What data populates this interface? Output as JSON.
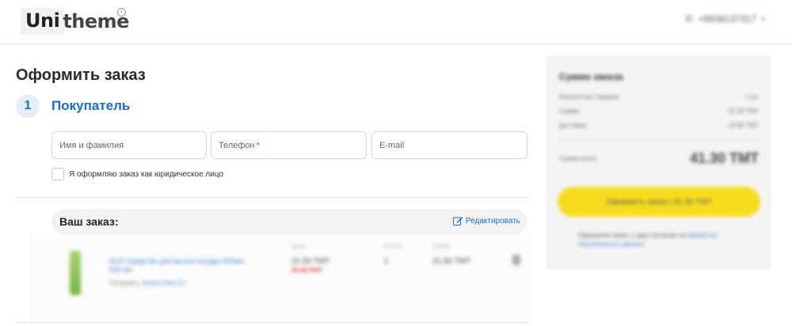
{
  "header": {
    "logo_a": "Uni",
    "logo_b": "theme",
    "phone": "+8938137317"
  },
  "checkout": {
    "title": "Оформить заказ",
    "step_number": "1",
    "step_title": "Покупатель",
    "fields": {
      "name_placeholder": "Имя и фамилия",
      "phone_placeholder": "Телефон",
      "phone_required": "*",
      "email_placeholder": "E-mail"
    },
    "legal_entity_label": "Я оформляю заказ как юридическое лицо",
    "order_title": "Ваш заказ:",
    "edit_label": "Редактировать"
  },
  "product": {
    "name": "AUS Средство для мытья посуды 500мл, 500 мл",
    "seller": "Продавец: ",
    "seller_name": "Seaua Care Co",
    "headers": {
      "price": "Цена",
      "qty": "Кол-во",
      "total": "Сумма"
    },
    "price": "21.50 TMT",
    "old_price": "25.00 TMT",
    "qty": "1",
    "total": "21.50 TMT"
  },
  "summary": {
    "title": "Сумма заказа",
    "rows": [
      {
        "label": "Количество товаров",
        "value": "1 шт"
      },
      {
        "label": "Сумма",
        "value": "21.50 TMT"
      },
      {
        "label": "Доставка",
        "value": "19.80 TMT"
      }
    ],
    "total_label": "Сумма итого",
    "total_value": "41.30 TMT",
    "checkout_button": "Оформить заказ | 41.30 TMT",
    "consent_text": "Оформляя заказ, я даю согласие на ",
    "consent_link": "обработку персональных данных"
  },
  "colors": {
    "accent_blue": "#1a6fc2",
    "button_yellow": "#f7dc1e",
    "required_red": "#e53935"
  }
}
